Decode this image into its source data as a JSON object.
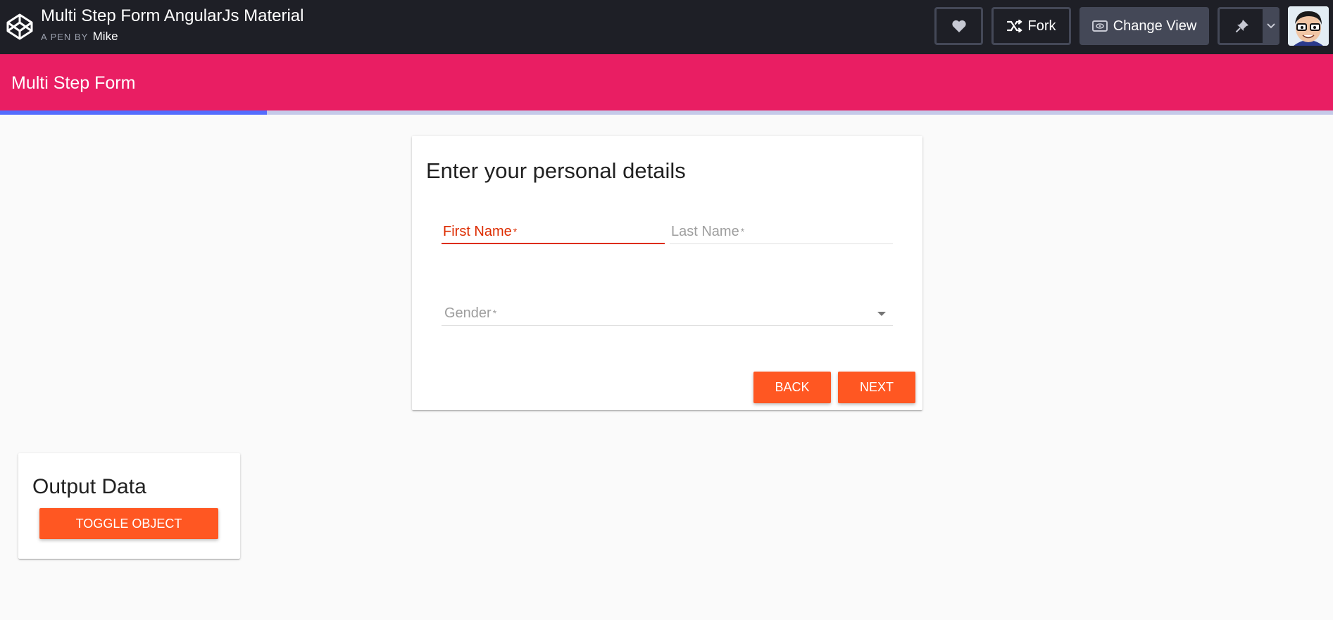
{
  "codepen": {
    "title": "Multi Step Form AngularJs Material",
    "by_label": "A PEN BY",
    "author": "Mike",
    "fork_label": "Fork",
    "change_view_label": "Change View"
  },
  "app": {
    "toolbar_title": "Multi Step Form",
    "progress_fraction": 0.2,
    "colors": {
      "toolbar": "#e91e63",
      "progress": "#536dfe",
      "progress_track": "#c5cae9",
      "accent": "#ff5722",
      "error": "#dd2c00"
    }
  },
  "form": {
    "heading": "Enter your personal details",
    "first_name_label": "First Name",
    "last_name_label": "Last Name",
    "gender_label": "Gender",
    "required_mark": "*",
    "back_label": "BACK",
    "next_label": "NEXT"
  },
  "output": {
    "heading": "Output Data",
    "toggle_label": "TOGGLE OBJECT"
  },
  "icons": [
    "codepen-logo-icon",
    "heart-icon",
    "fork-icon",
    "eye-icon",
    "pin-icon",
    "chevron-down-icon",
    "avatar"
  ]
}
